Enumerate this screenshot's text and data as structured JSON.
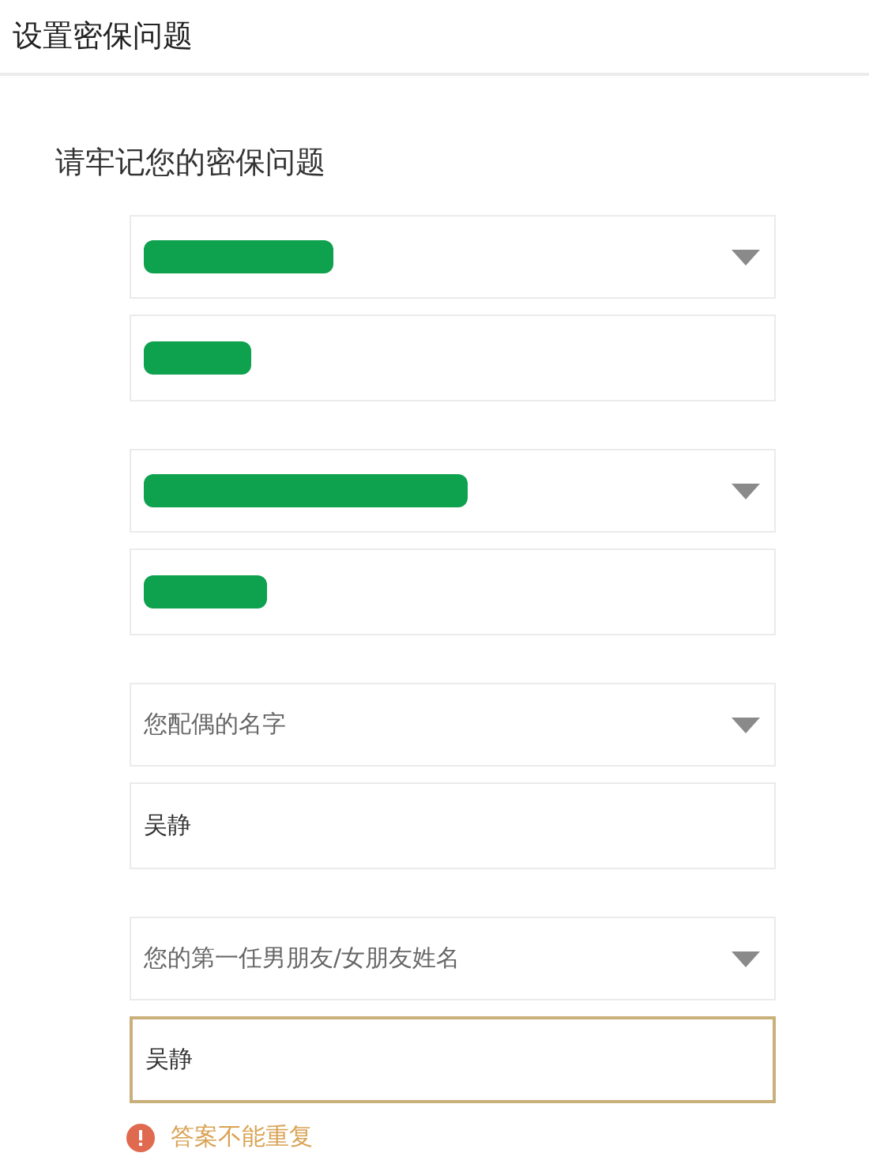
{
  "header": {
    "title": "设置密保问题"
  },
  "heading": "请牢记您的密保问题",
  "questions": [
    {
      "question": {
        "kind": "redacted"
      },
      "answer": {
        "kind": "redacted",
        "error": false
      }
    },
    {
      "question": {
        "kind": "redacted"
      },
      "answer": {
        "kind": "redacted",
        "error": false
      }
    },
    {
      "question": {
        "kind": "text",
        "text": "您配偶的名字"
      },
      "answer": {
        "kind": "text",
        "value": "吴静",
        "error": false
      }
    },
    {
      "question": {
        "kind": "text",
        "text": "您的第一任男朋友/女朋友姓名"
      },
      "answer": {
        "kind": "text",
        "value": "吴静",
        "error": true
      }
    }
  ],
  "error_message": "答案不能重复"
}
